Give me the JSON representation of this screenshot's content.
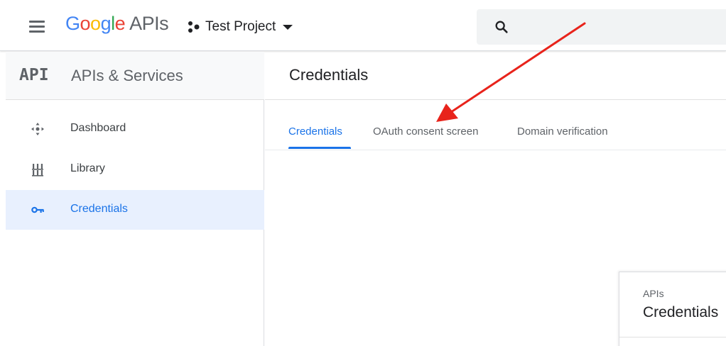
{
  "header": {
    "brand_letters": [
      "G",
      "o",
      "o",
      "g",
      "l",
      "e"
    ],
    "brand_suffix": "APIs",
    "project_name": "Test Project",
    "search_placeholder": ""
  },
  "sidebar": {
    "logo_text": "API",
    "title": "APIs & Services",
    "items": [
      {
        "label": "Dashboard",
        "icon": "dashboard-icon"
      },
      {
        "label": "Library",
        "icon": "library-icon"
      },
      {
        "label": "Credentials",
        "icon": "key-icon",
        "active": true
      }
    ]
  },
  "main": {
    "title": "Credentials",
    "tabs": [
      {
        "label": "Credentials",
        "active": true
      },
      {
        "label": "OAuth consent screen"
      },
      {
        "label": "Domain verification"
      }
    ]
  },
  "card": {
    "kicker": "APIs",
    "title": "Credentials"
  },
  "colors": {
    "accent": "#1a73e8",
    "active_bg": "#e8f0fe",
    "annotation_arrow": "#e8231b"
  }
}
